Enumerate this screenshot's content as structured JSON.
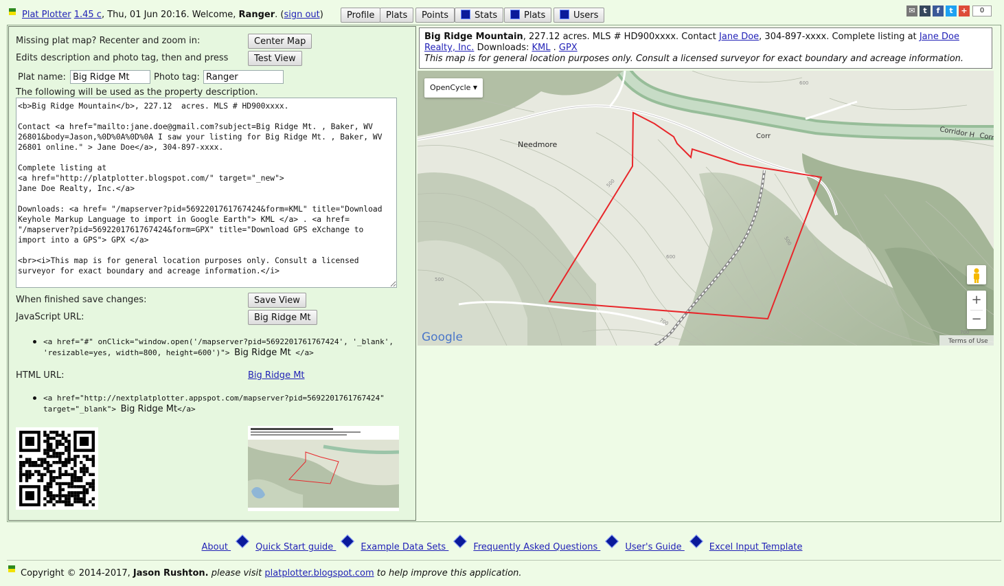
{
  "header": {
    "app_name": "Plat Plotter",
    "version": "1.45 c",
    "datetime": "Thu, 01 Jun 20:16.",
    "welcome": "Welcome,",
    "user": "Ranger",
    "sign_out": "sign out",
    "buttons": {
      "profile": "Profile",
      "plats": "Plats",
      "points": "Points"
    },
    "tab_buttons": {
      "stats": "Stats",
      "plats": "Plats",
      "users": "Users"
    },
    "share_count": "0",
    "social_icons": [
      "email-icon",
      "tumblr-icon",
      "facebook-icon",
      "twitter-icon",
      "google-plus-icon"
    ]
  },
  "left": {
    "row1_label": "Missing plat map? Recenter and zoom in:",
    "center_map": "Center Map",
    "row2_label": "Edits description and photo tag, then and press",
    "test_view": "Test View",
    "plat_name_label": "Plat name:",
    "plat_name_value": "Big Ridge Mt",
    "photo_tag_label": "Photo tag:",
    "photo_tag_value": "Ranger",
    "desc_label": "The following will be used as the property description.",
    "description": "<b>Big Ridge Mountain</b>, 227.12  acres. MLS # HD900xxxx.\n\nContact <a href=\"mailto:jane.doe@gmail.com?subject=Big Ridge Mt. , Baker, WV 26801&body=Jason,%0D%0A%0D%0A I saw your listing for Big Ridge Mt. , Baker, WV 26801 online.\" > Jane Doe</a>, 304-897-xxxx.\n\nComplete listing at\n<a href=\"http://platplotter.blogspot.com/\" target=\"_new\">\nJane Doe Realty, Inc.</a>\n\nDownloads: <a href= \"/mapserver?pid=5692201761767424&form=KML\" title=\"Download Keyhole Markup Language to import in Google Earth\"> KML </a> . <a href= \"/mapserver?pid=5692201761767424&form=GPX\" title=\"Download GPS eXchange to import into a GPS\"> GPX </a>\n\n<br><i>This map is for general location purposes only. Consult a licensed surveyor for exact boundary and acreage information.</i>",
    "save_label": "When finished save changes:",
    "save_view": "Save View",
    "js_label": "JavaScript URL:",
    "js_button": "Big Ridge Mt",
    "js_code_line1": "<a href=\"#\" onClick=\"window.open('/mapserver?pid=5692201761767424', '_blank',",
    "js_code_line2": "'resizable=yes, width=800, height=600')\">",
    "js_code_text": "Big Ridge Mt",
    "js_code_end": "</a>",
    "html_label": "HTML URL:",
    "html_link": "Big Ridge Mt",
    "html_code_line1": "<a href=\"http://nextplatplotter.appspot.com/mapserver?pid=5692201761767424\"",
    "html_code_line2": "target=\"_blank\">",
    "html_code_text": "Big Ridge Mt",
    "html_code_end": "</a>"
  },
  "info": {
    "name": "Big Ridge Mountain",
    "acres_text": ", 227.12 acres. MLS # HD900xxxx. Contact",
    "contact": "Jane Doe",
    "phone_text": ", 304-897-xxxx. Complete listing at",
    "realty": "Jane Doe Realty, Inc.",
    "downloads_label": "Downloads:",
    "kml": "KML",
    "gpx": "GPX",
    "disclaimer": "This map is for general location purposes only. Consult a licensed surveyor for exact boundary and acreage information."
  },
  "map": {
    "layer": "OpenCycle",
    "place_label": "Needmore",
    "road1": "Corr",
    "road2": "Corridor H",
    "road3": "Corr",
    "contour_500a": "500",
    "contour_500b": "500",
    "contour_500c": "500",
    "contour_600a": "600",
    "contour_600b": "600",
    "contour_700a": "700",
    "contour_700b": "700",
    "google": "Google",
    "terms": "Terms of Use",
    "zoom_in": "+",
    "zoom_out": "−",
    "boundary_color": "#e8262a"
  },
  "footer": {
    "links": [
      "About",
      "Quick Start guide",
      "Example Data Sets",
      "Frequently Asked Questions",
      "User's Guide",
      "Excel Input Template"
    ],
    "copyright_pre": "Copyright © 2014-2017,",
    "author": "Jason Rushton.",
    "please": "please visit",
    "blog": "platplotter.blogspot.com",
    "help": "to help improve this application."
  }
}
